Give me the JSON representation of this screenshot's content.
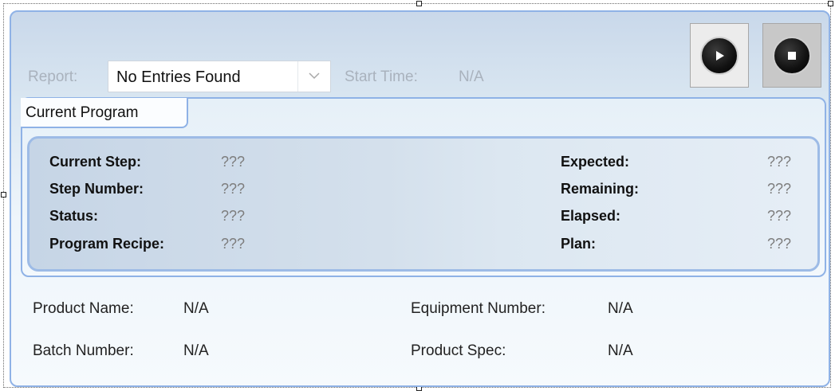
{
  "report": {
    "label": "Report:",
    "selected_value": "No Entries Found",
    "start_time_label": "Start Time:",
    "start_time_value": "N/A"
  },
  "toolbar": {
    "play_icon": "play-icon",
    "stop_icon": "stop-icon"
  },
  "current_program": {
    "tab_label": "Current Program",
    "left_fields": [
      {
        "label": "Current Step:",
        "value": "???"
      },
      {
        "label": "Step Number:",
        "value": "???"
      },
      {
        "label": "Status:",
        "value": "???"
      },
      {
        "label": "Program Recipe:",
        "value": "???"
      }
    ],
    "right_fields": [
      {
        "label": "Expected:",
        "value": "???"
      },
      {
        "label": "Remaining:",
        "value": "???"
      },
      {
        "label": "Elapsed:",
        "value": "???"
      },
      {
        "label": "Plan:",
        "value": "???"
      }
    ]
  },
  "details": {
    "product_name_label": "Product Name:",
    "product_name_value": "N/A",
    "equipment_number_label": "Equipment Number:",
    "equipment_number_value": "N/A",
    "batch_number_label": "Batch Number:",
    "batch_number_value": "N/A",
    "product_spec_label": "Product Spec:",
    "product_spec_value": "N/A"
  },
  "colors": {
    "panel_border": "#8fb2e6",
    "dim_text": "#a9b2bd"
  }
}
